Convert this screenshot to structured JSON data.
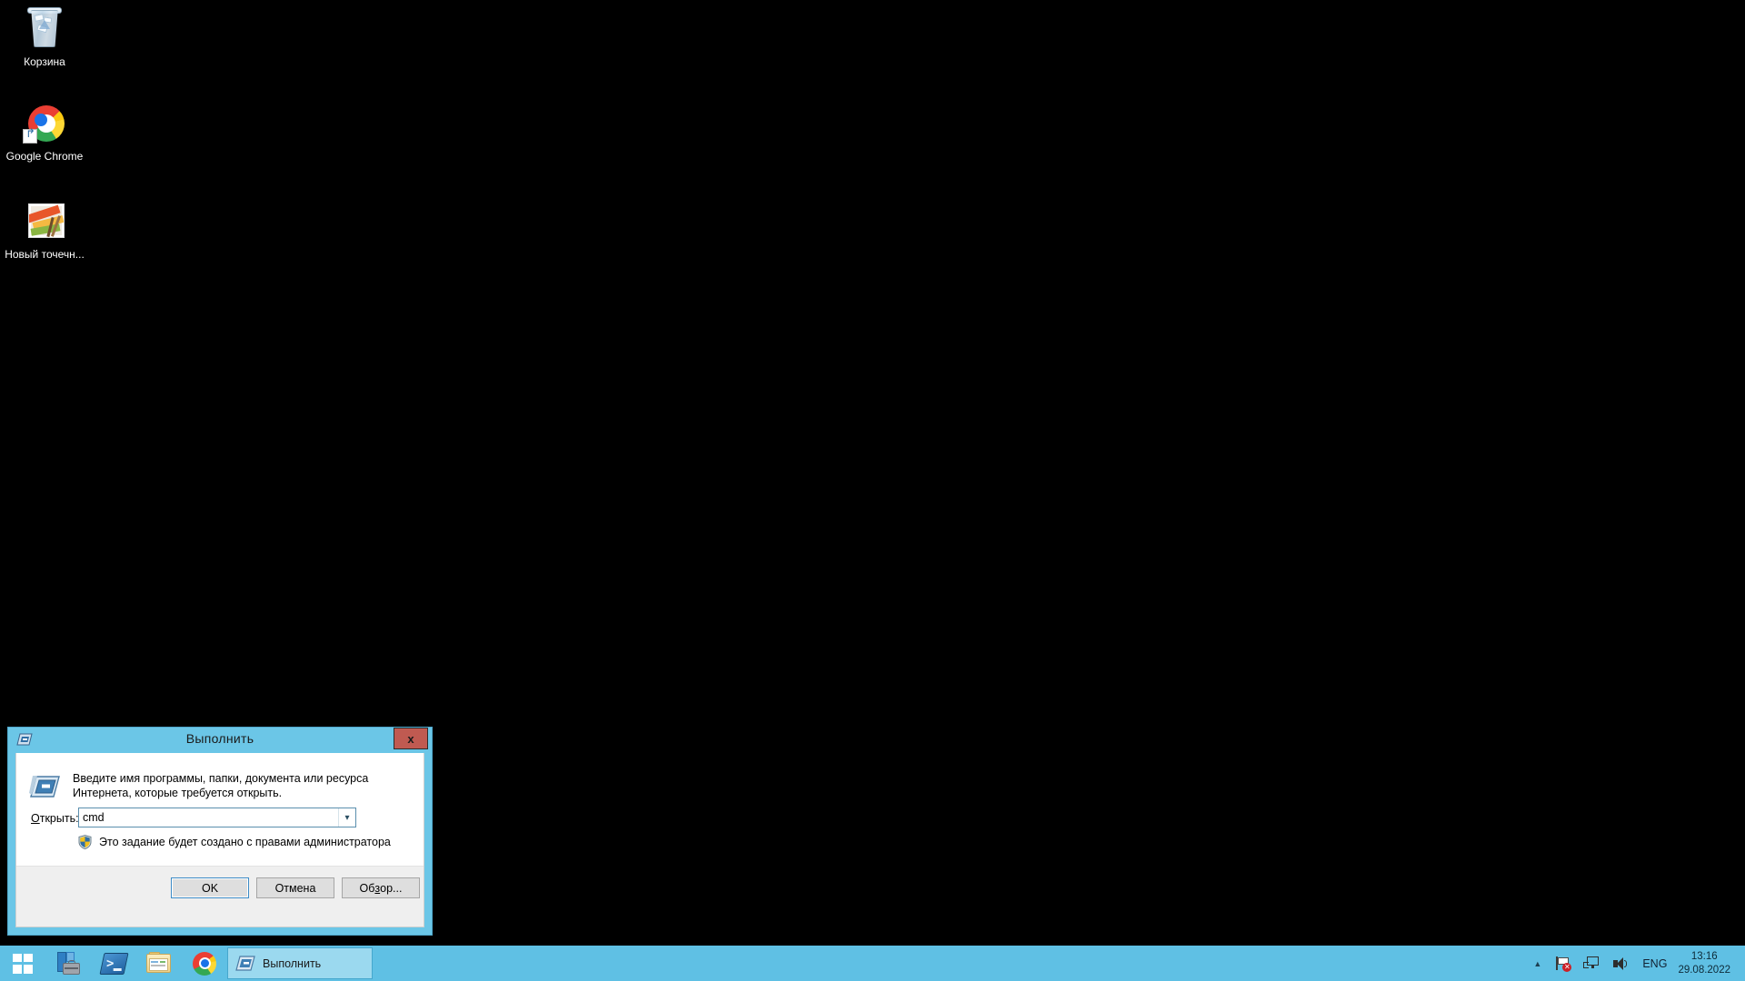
{
  "desktop": {
    "background_color": "#000000",
    "icons": [
      {
        "name": "recycle-bin",
        "label": "Корзина",
        "icon": "recycle-bin-icon"
      },
      {
        "name": "google-chrome",
        "label": "Google Chrome",
        "icon": "chrome-icon"
      },
      {
        "name": "new-bitmap-image",
        "label": "Новый точечн...",
        "icon": "bitmap-image-icon"
      }
    ]
  },
  "run_dialog": {
    "title": "Выполнить",
    "titlebar_color": "#6BC6E7",
    "close_button": {
      "label": "x",
      "name": "close-button",
      "color": "#C05A51"
    },
    "titlebar_icon": "run-icon",
    "body_icon": "run-icon",
    "description": "Введите имя программы, папки, документа или ресурса Интернета, которые требуется открыть.",
    "open_label_prefix": "О",
    "open_label_rest": "ткрыть:",
    "input": {
      "value": "cmd",
      "placeholder": ""
    },
    "combo_arrow": "chevron-down-icon",
    "uac": {
      "icon": "uac-shield-icon",
      "text": "Это задание будет создано с правами администратора"
    },
    "buttons": [
      {
        "name": "ok-button",
        "label": "OK",
        "default": true
      },
      {
        "name": "cancel-button",
        "label": "Отмена",
        "default": false
      },
      {
        "name": "browse-button",
        "label_pre": "Об",
        "label_accel": "з",
        "label_post": "ор...",
        "default": false
      }
    ]
  },
  "taskbar": {
    "background_color": "#5FC0E4",
    "start": {
      "name": "start-button",
      "icon": "windows-logo-icon"
    },
    "pinned": [
      {
        "name": "server-manager",
        "icon": "server-manager-icon"
      },
      {
        "name": "windows-powershell",
        "icon": "powershell-icon"
      },
      {
        "name": "file-explorer",
        "icon": "folder-icon"
      },
      {
        "name": "google-chrome",
        "icon": "chrome-icon"
      }
    ],
    "active_task": {
      "label": "Выполнить",
      "icon": "run-icon"
    },
    "tray": {
      "chevron": "chevron-up-icon",
      "action_center": {
        "icon": "flag-icon",
        "badge": "✕"
      },
      "network": {
        "icon": "network-icon"
      },
      "volume": {
        "icon": "speaker-icon"
      },
      "language": "ENG",
      "clock": {
        "time": "13:16",
        "date": "29.08.2022"
      }
    }
  }
}
